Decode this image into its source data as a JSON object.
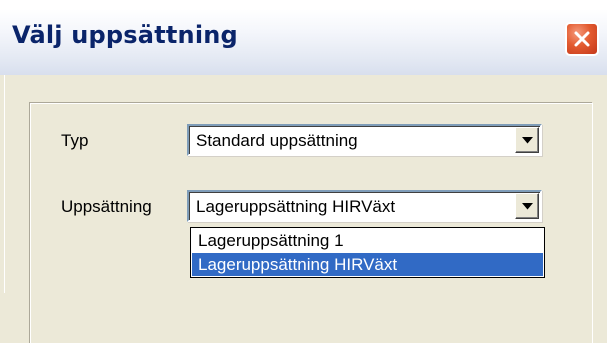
{
  "window": {
    "title": "Välj uppsättning",
    "close_icon": "close-icon",
    "close_color": "#e35b30"
  },
  "form": {
    "typ": {
      "label": "Typ",
      "value": "Standard uppsättning",
      "arrow_icon": "chevron-down-icon"
    },
    "uppsattning": {
      "label": "Uppsättning",
      "value": "Lageruppsättning HIRVäxt",
      "arrow_icon": "chevron-down-icon",
      "options": [
        {
          "label": "Lageruppsättning 1",
          "selected": false
        },
        {
          "label": "Lageruppsättning HIRVäxt",
          "selected": true
        }
      ]
    }
  },
  "colors": {
    "selection": "#316ac5",
    "dialog_bg": "#ece9d8",
    "title_text": "#0a246a"
  }
}
